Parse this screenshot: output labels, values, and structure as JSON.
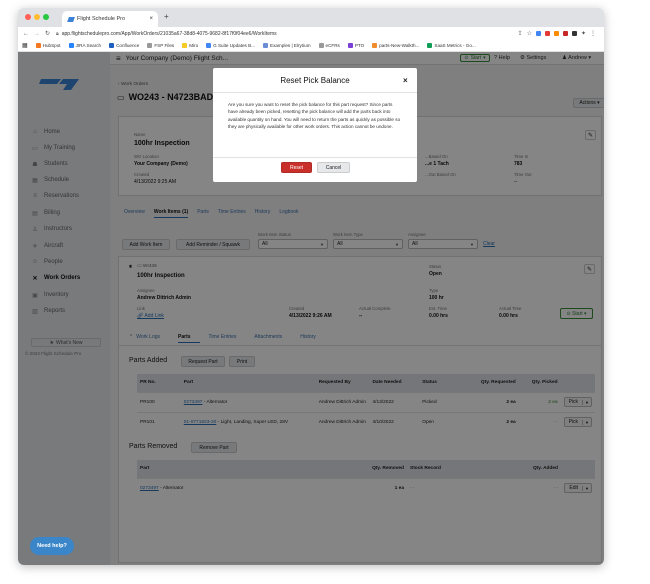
{
  "browser": {
    "tab_title": "Flight Schedule Pro",
    "url": "app.flightschedulepro.com/App/WorkOrders/21035a67-38d8-4075-9682-8f17f0f04ee6/WorkItems",
    "bookmarks": [
      {
        "label": "HubSpot",
        "color": "#f57722"
      },
      {
        "label": "JIRA Search",
        "color": "#2684ff"
      },
      {
        "label": "Confluence",
        "color": "#1d5fbf"
      },
      {
        "label": "FSP Files",
        "color": "#999999"
      },
      {
        "label": "Miro",
        "color": "#f7c925"
      },
      {
        "label": "G Suite Updates B...",
        "color": "#4285f4"
      },
      {
        "label": "Examples | Elrytium",
        "color": "#6b8dd6"
      },
      {
        "label": "eCFRs",
        "color": "#999999"
      },
      {
        "label": "PTO",
        "color": "#7b3fd6"
      },
      {
        "label": "parts-New-Walkth...",
        "color": "#f08c2e"
      },
      {
        "label": "SaaS Metrics - Go...",
        "color": "#0f9d58"
      }
    ]
  },
  "header": {
    "company": "Your Company (Demo) Flight Sch...",
    "start_label": "Start",
    "help_label": "Help",
    "settings_label": "Settings",
    "user_label": "Andrew"
  },
  "sidebar": {
    "items": [
      {
        "label": "Home",
        "icon": "home-icon",
        "glyph": "⌂"
      },
      {
        "label": "My Training",
        "icon": "training-icon",
        "glyph": "▭"
      },
      {
        "label": "Students",
        "icon": "students-icon",
        "glyph": "☗"
      },
      {
        "label": "Schedule",
        "icon": "calendar-icon",
        "glyph": "▦"
      },
      {
        "label": "Reservations",
        "icon": "list-icon",
        "glyph": "≡"
      },
      {
        "label": "Billing",
        "icon": "billing-icon",
        "glyph": "▤"
      },
      {
        "label": "Instructors",
        "icon": "instructor-icon",
        "glyph": "♙"
      },
      {
        "label": "Aircraft",
        "icon": "aircraft-icon",
        "glyph": "✈"
      },
      {
        "label": "People",
        "icon": "people-icon",
        "glyph": "☺"
      },
      {
        "label": "Work Orders",
        "icon": "wrench-icon",
        "glyph": "✕"
      },
      {
        "label": "Inventory",
        "icon": "inventory-icon",
        "glyph": "▣"
      },
      {
        "label": "Reports",
        "icon": "reports-icon",
        "glyph": "▥"
      }
    ],
    "whats_new": "What's New",
    "copyright": "© 2022 Flight Schedule Pro"
  },
  "workorder": {
    "back_label": "Work Orders",
    "title": "WO243 - N4723BAD",
    "actions_label": "Actions",
    "name_label": "Name",
    "name_value": "100hr Inspection",
    "location_label": "WO Location",
    "location_value": "Your Company (Demo)",
    "created_label": "Created",
    "created_value": "4/13/2022 9:25 AM",
    "based_on_label": "...Based On",
    "based_on_value": "...e 1 Tach",
    "time_in_label": "Time In",
    "time_in_value": "783",
    "last_based_label": "...Out Based On",
    "time_out_label": "Time Out",
    "time_out_value": "--"
  },
  "wo_tabs": [
    "Overview",
    "Work Items (1)",
    "Parts",
    "Time Entries",
    "History",
    "Logbook"
  ],
  "filters": {
    "add_work_item": "Add Work Item",
    "add_reminder": "Add Reminder / Squawk",
    "all_label": "All",
    "status_label": "Work Item Status",
    "status_value": "All",
    "type_label": "Work Item Type",
    "type_value": "All",
    "assignee_label": "Assignee",
    "assignee_value": "All",
    "clear_label": "Clear"
  },
  "workitem": {
    "number": "WI436",
    "title": "100hr Inspection",
    "status_label": "Status",
    "status_value": "Open",
    "assignee_label": "Assignee",
    "assignee_value": "Andrew Dittrich Admin",
    "type_label": "Type",
    "type_value": "100 hr",
    "link_label": "Link",
    "add_link": "Add Link",
    "created_label": "Created",
    "created_value": "4/13/2022 9:26 AM",
    "actual_complete_label": "Actual Complete",
    "actual_complete_value": "--",
    "est_time_label": "Est. Time",
    "est_time_value": "0.00 hrs",
    "actual_time_label": "Actual Time",
    "actual_time_value": "0.00 hrs",
    "start_label": "Start"
  },
  "item_tabs": [
    "Work Logs",
    "Parts",
    "Time Entries",
    "Attachments",
    "History"
  ],
  "parts_added": {
    "title": "Parts Added",
    "request_label": "Request Part",
    "print_label": "Print",
    "columns": [
      "PR No.",
      "Part",
      "Requested By",
      "Date Needed",
      "Status",
      "Qty. Requested",
      "Qty. Picked"
    ],
    "rows": [
      {
        "pr": "PR100",
        "part_no": "0273497",
        "part_desc": "- Alternator",
        "requested_by": "Andrew Dittrich Admin",
        "date": "4/13/2022",
        "status": "Picked",
        "qty_req": "2 ea",
        "qty_picked": "2 ea",
        "action": "Pick"
      },
      {
        "pr": "PR101",
        "part_no": "01-0771833-20",
        "part_desc": "- Light, Landing, Super LED, 28V",
        "requested_by": "Andrew Dittrich Admin",
        "date": "4/10/2022",
        "status": "Open",
        "qty_req": "2 ea",
        "qty_picked": "- -",
        "action": "Pick"
      }
    ]
  },
  "parts_removed": {
    "title": "Parts Removed",
    "remove_label": "Remove Part",
    "columns": [
      "Part",
      "Qty. Removed",
      "Stock Record",
      "Qty. Added"
    ],
    "rows": [
      {
        "part_no": "0273497",
        "part_desc": "- Alternator",
        "qty_removed": "1 ea",
        "stock": "- -",
        "qty_added": "- -",
        "action": "Edit"
      }
    ]
  },
  "modal": {
    "title": "Reset Pick Balance",
    "close": "×",
    "body": "Are you sure you want to reset the pick balance for this part request? Since parts have already been picked, resetting the pick balance will add the parts back into available quantity on hand. You will need to return the parts as quickly as possible so they are physically available for other work orders. This action cannot be undone.",
    "reset_label": "Reset",
    "cancel_label": "Cancel"
  },
  "help_label": "Need help?",
  "colors": {
    "accent": "#2a6fb5",
    "danger": "#c9302c",
    "logo": "#3b82d6"
  }
}
